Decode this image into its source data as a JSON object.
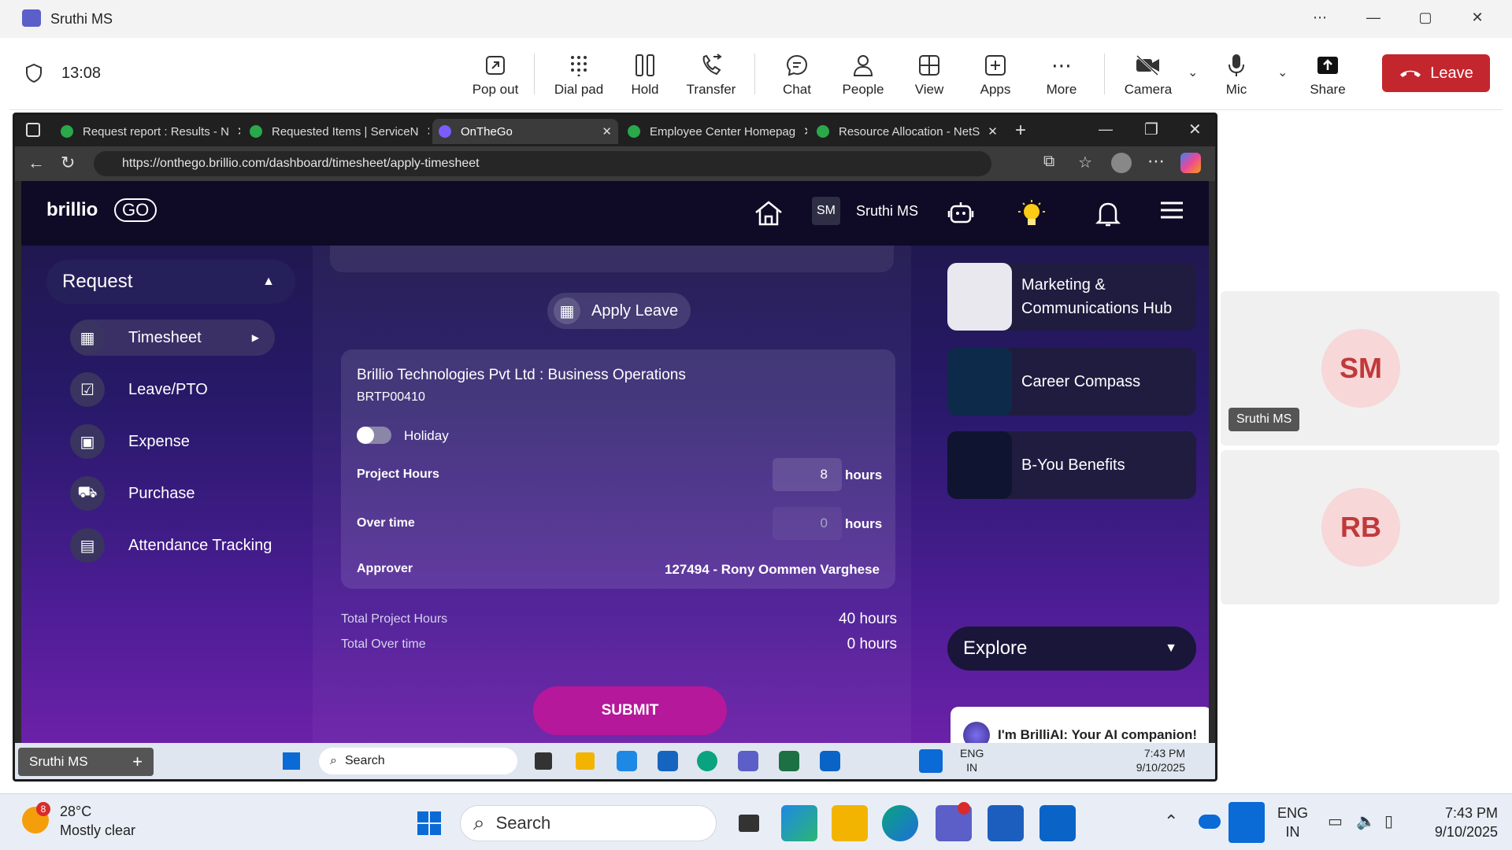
{
  "teams": {
    "window_title": "Sruthi MS",
    "meeting_timer": "13:08",
    "toolbar": {
      "pop_out": "Pop out",
      "dial_pad": "Dial pad",
      "hold": "Hold",
      "transfer": "Transfer",
      "chat": "Chat",
      "people": "People",
      "view": "View",
      "apps": "Apps",
      "more": "More",
      "camera": "Camera",
      "mic": "Mic",
      "share": "Share",
      "leave": "Leave"
    },
    "participants": [
      {
        "initials": "SM",
        "name": "Sruthi MS",
        "color": "#f7d7d7"
      },
      {
        "initials": "RB",
        "name": "",
        "color": "#f7d7d7"
      }
    ],
    "leave_color": "#c4262e"
  },
  "browser": {
    "tabs": [
      {
        "title": "Request report : Results - N",
        "fav_color": "#2aa84a"
      },
      {
        "title": "Requested Items | ServiceN",
        "fav_color": "#2aa84a"
      },
      {
        "title": "OnTheGo",
        "fav_color": "#7b5cff",
        "active": true
      },
      {
        "title": "Employee Center Homepag",
        "fav_color": "#2aa84a"
      },
      {
        "title": "Resource Allocation - NetS",
        "fav_color": "#2aa84a"
      }
    ],
    "url": "https://onthego.brillio.com/dashboard/timesheet/apply-timesheet"
  },
  "site": {
    "logo": "brillio",
    "logo_sub": "GO",
    "user_initials": "SM",
    "user_name": "Sruthi MS",
    "sidebar": {
      "header": "Request",
      "items": [
        {
          "label": "Timesheet",
          "icon": "timesheet-icon"
        },
        {
          "label": "Leave/PTO",
          "icon": "leave-icon"
        },
        {
          "label": "Expense",
          "icon": "expense-icon"
        },
        {
          "label": "Purchase",
          "icon": "cart-icon"
        },
        {
          "label": "Attendance Tracking",
          "icon": "calendar-icon"
        }
      ]
    },
    "form": {
      "apply_leave": "Apply Leave",
      "project_name": "Brillio Technologies Pvt Ltd : Business Operations",
      "project_code": "BRTP00410",
      "holiday_label": "Holiday",
      "holiday_on": false,
      "project_hours_label": "Project Hours",
      "project_hours_value": "8",
      "overtime_label": "Over time",
      "overtime_value": "0",
      "hours_unit": "hours",
      "approver_label": "Approver",
      "approver_value": "127494 - Rony Oommen Varghese",
      "total_project_hours_label": "Total Project Hours",
      "total_project_hours_value": "40 hours",
      "total_overtime_label": "Total Over time",
      "total_overtime_value": "0 hours",
      "submit": "SUBMIT"
    },
    "right_cards": [
      {
        "label": "Marketing & Communications Hub",
        "thumb": "#e8e8ee"
      },
      {
        "label": "Career Compass",
        "thumb": "#0e2a4a"
      },
      {
        "label": "B-You Benefits",
        "thumb": "#0f1430"
      }
    ],
    "explore": "Explore",
    "brilliai": "I'm BrilliAI: Your AI companion!"
  },
  "inner_taskbar": {
    "presenter": "Sruthi MS",
    "search": "Search",
    "lang_top": "ENG",
    "lang_bottom": "IN",
    "time": "7:43 PM",
    "date": "9/10/2025"
  },
  "outer_taskbar": {
    "temperature": "28°C",
    "weather": "Mostly clear",
    "weather_badge": "8",
    "search": "Search",
    "lang_top": "ENG",
    "lang_bottom": "IN",
    "time": "7:43 PM",
    "date": "9/10/2025"
  }
}
